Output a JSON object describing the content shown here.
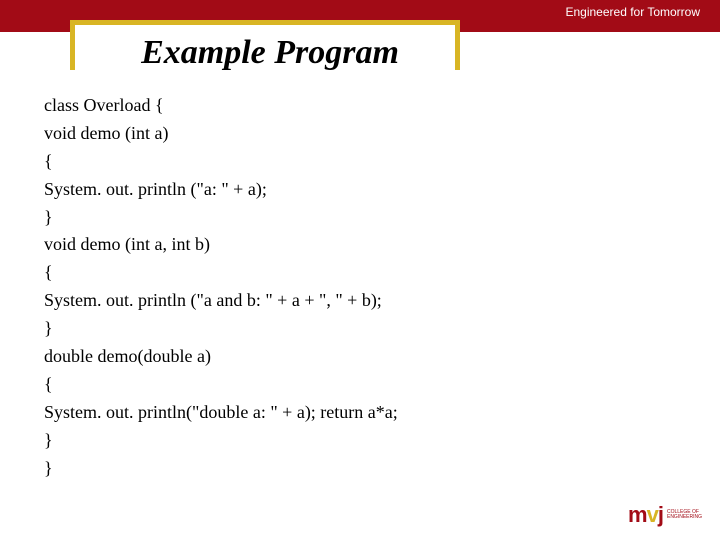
{
  "header": {
    "tagline": "Engineered for Tomorrow"
  },
  "title": "Example Program",
  "code": {
    "lines": [
      "class Overload {",
      " void demo (int a)",
      "{",
      "System. out. println (\"a: \" + a);",
      "}",
      "void demo (int a, int b)",
      "{",
      " System. out. println (\"a and b: \" + a + \", \" + b);",
      "}",
      "double demo(double a)",
      "{",
      "System. out. println(\"double a: \" + a); return a*a;",
      "}",
      "}"
    ]
  },
  "logo": {
    "mark_pre": "m",
    "mark_v": "v",
    "mark_post": "j",
    "text_line1": "College of",
    "text_line2": "Engineering"
  }
}
